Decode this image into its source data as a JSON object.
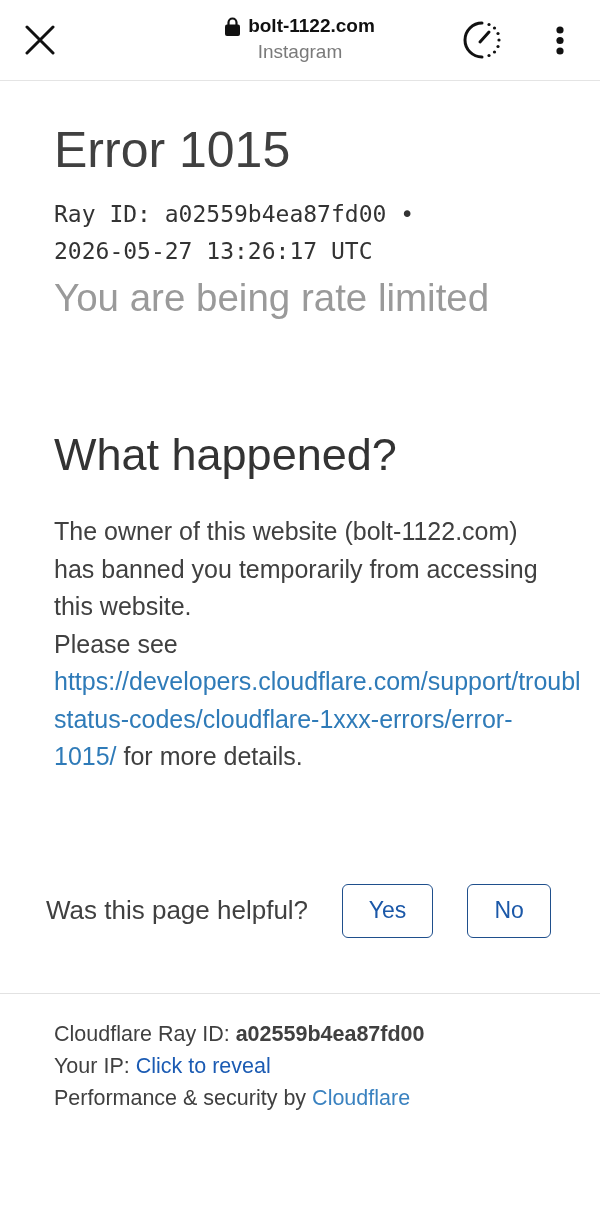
{
  "browser_bar": {
    "domain": "bolt-1122.com",
    "subtitle": "Instagram"
  },
  "error": {
    "title": "Error 1015",
    "ray_line": "Ray ID: a02559b4ea87fd00 •",
    "timestamp": "2026-05-27 13:26:17 UTC",
    "subtitle": "You are being rate limited"
  },
  "what_happened": {
    "heading": "What happened?",
    "paragraph": "The owner of this website (bolt-1122.com) has banned you temporarily from accessing this website.",
    "details": {
      "before": "Please see",
      "link_lines": [
        "https://developers.cloudflare.com/support/troubl",
        "status-codes/cloudflare-1xxx-errors/error-",
        "1015/"
      ],
      "after": "for more details."
    }
  },
  "feedback": {
    "question": "Was this page helpful?",
    "buttons": [
      "Yes",
      "No"
    ]
  },
  "footer": {
    "ray_id": "Cloudflare Ray ID: **a02559b4ea87fd00**",
    "ip": {
      "label": "Your IP:",
      "link": "Click to reveal"
    },
    "credit": {
      "label": "Performance & security by",
      "link": "Cloudflare"
    }
  }
}
